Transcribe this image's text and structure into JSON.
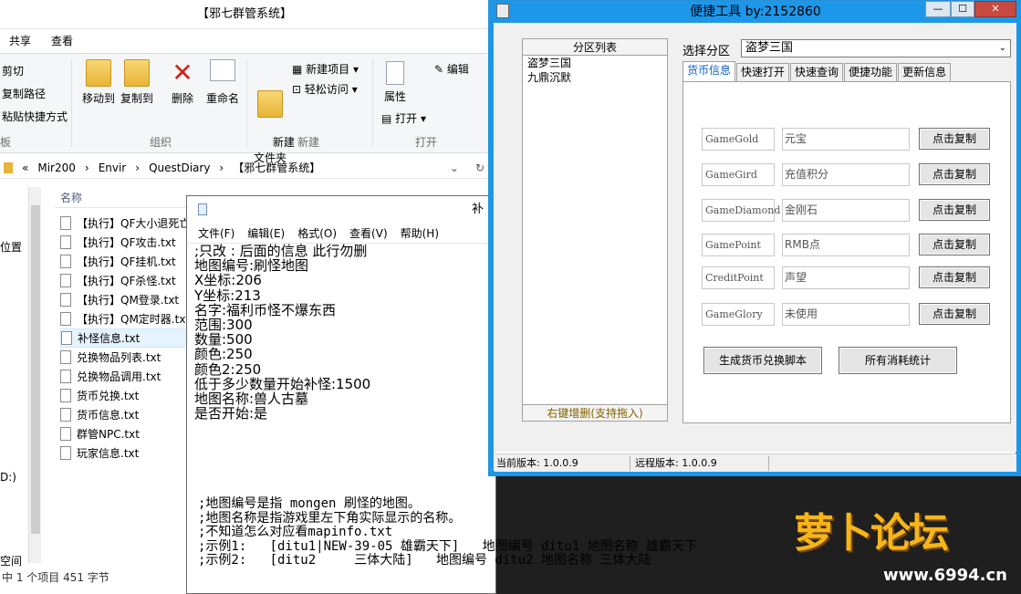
{
  "explorer": {
    "title": "【邪七群管系统】",
    "menu": [
      "共享",
      "查看"
    ],
    "ribbon": {
      "cut": "剪切",
      "copy_path": "复制路径",
      "paste_shortcut": "粘贴快捷方式",
      "clipboard_group": "板",
      "move_to": "移动到",
      "copy_to": "复制到",
      "delete": "删除",
      "rename": "重命名",
      "organize_group": "组织",
      "new_folder": "新建\n文件夹",
      "new_item": "新建项目",
      "easy_access": "轻松访问",
      "new_group": "新建",
      "properties": "属性",
      "open": "打开",
      "edit": "编辑",
      "open_group": "打开"
    },
    "address": [
      "«",
      "Mir200",
      "›",
      "Envir",
      "›",
      "QuestDiary",
      "›",
      "【邪七群管系统】"
    ],
    "nav_left": [
      "位置",
      "D:)",
      "空间"
    ],
    "column_name": "名称",
    "files": [
      "【执行】QF大小退死亡",
      "【执行】QF攻击.txt",
      "【执行】QF挂机.txt",
      "【执行】QF杀怪.txt",
      "【执行】QM登录.txt",
      "【执行】QM定时器.txt",
      "补怪信息.txt",
      "兑换物品列表.txt",
      "兑换物品调用.txt",
      "货币兑换.txt",
      "货币信息.txt",
      "群管NPC.txt",
      "玩家信息.txt"
    ],
    "selected_index": 6,
    "status": "中 1 个项目  451 字节"
  },
  "notepad": {
    "title_fragment": "补",
    "menu": [
      "文件(F)",
      "编辑(E)",
      "格式(O)",
      "查看(V)",
      "帮助(H)"
    ],
    "lines": [
      ";只改 : 后面的信息 此行勿删",
      "地图编号:刷怪地图",
      "X坐标:206",
      "Y坐标:213",
      "名字:福利币怪不爆东西",
      "范围:300",
      "数量:500",
      "颜色:250",
      "颜色2:250",
      "低于多少数量开始补怪:1500",
      "地图名称:兽人古墓",
      "是否开始:是"
    ],
    "comments": [
      ";地图编号是指 mongen 刷怪的地图。",
      ";地图名称是指游戏里左下角实际显示的名称。",
      ";不知道怎么对应看mapinfo.txt",
      ";示例1:   [ditu1|NEW-39-05 雄霸天下]   地图编号 ditu1 地图名称 雄霸天下",
      ";示例2:   [ditu2     三体大陆]   地图编号 ditu2 地图名称 三体大陆"
    ]
  },
  "tool": {
    "title": "便捷工具 by:2152860",
    "list_header": "分区列表",
    "list_items": [
      "盗梦三国",
      "九鼎沉默"
    ],
    "list_footer": "右键增删(支持拖入)",
    "select_label": "选择分区",
    "select_value": "盗梦三国",
    "tabs": [
      "货币信息",
      "快速打开",
      "快速查询",
      "便捷功能",
      "更新信息"
    ],
    "active_tab": 0,
    "currencies": [
      {
        "code": "GameGold",
        "name": "元宝",
        "button": "点击复制"
      },
      {
        "code": "GameGird",
        "name": "充值积分",
        "button": "点击复制"
      },
      {
        "code": "GameDiamond",
        "name": "金刚石",
        "button": "点击复制"
      },
      {
        "code": "GamePoint",
        "name": "RMB点",
        "button": "点击复制"
      },
      {
        "code": "CreditPoint",
        "name": "声望",
        "button": "点击复制"
      },
      {
        "code": "GameGlory",
        "name": "未使用",
        "button": "点击复制"
      }
    ],
    "gen_script_button": "生成货币兑换脚本",
    "stats_button": "所有消耗统计",
    "current_version": "当前版本: 1.0.0.9",
    "remote_version": "远程版本: 1.0.0.9"
  },
  "watermark": {
    "logo": "萝卜论坛",
    "url": "www.6994.cn"
  },
  "colors": {
    "titlebar_active": "#1c97ea",
    "close_button": "#c74a40",
    "list_footer": "#806000",
    "active_tab_text": "#0f5fbf"
  }
}
